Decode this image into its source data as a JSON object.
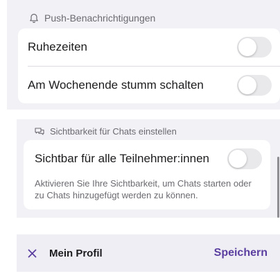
{
  "push_section": {
    "title": "Push-Benachrichtigungen",
    "icon": "bell-icon",
    "rows": [
      {
        "label": "Ruhezeiten",
        "toggle_on": false
      },
      {
        "label": "Am Wochenende stumm schalten",
        "toggle_on": false
      }
    ]
  },
  "visibility_section": {
    "title": "Sichtbarkeit für Chats einstellen",
    "icon": "chat-bubbles-icon",
    "toggle_label": "Sichtbar für alle Teilnehmer:innen",
    "toggle_on": false,
    "description": "Aktivieren Sie Ihre Sichtbarkeit, um Chats starten oder zu Chats hinzugefügt werden zu können."
  },
  "navbar": {
    "close_icon": "close-icon",
    "title": "Mein Profil",
    "save_label": "Speichern"
  },
  "colors": {
    "accent": "#5b3fa0",
    "grouped_background": "#f2f1f6",
    "toggle_off": "#e9e9eb"
  }
}
